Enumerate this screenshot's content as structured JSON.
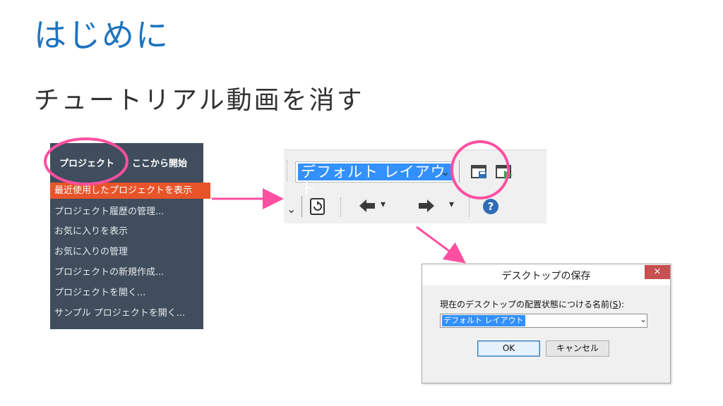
{
  "slide": {
    "title": "はじめに",
    "subtitle": "チュートリアル動画を消す"
  },
  "menu": {
    "tabs": [
      "プロジェクト",
      "ここから開始"
    ],
    "items": [
      {
        "label": "最近使用したプロジェクトを表示",
        "active": true
      },
      {
        "label": "プロジェクト履歴の管理..."
      },
      {
        "label": "お気に入りを表示"
      },
      {
        "label": "お気に入りの管理"
      },
      {
        "label": "プロジェクトの新規作成..."
      },
      {
        "label": "プロジェクトを開く..."
      },
      {
        "label": "サンプル プロジェクトを開く..."
      }
    ]
  },
  "toolbar": {
    "layout_value": "デフォルト レイアウト",
    "icons": [
      "save-layout-icon",
      "restore-layout-icon",
      "refresh-icon",
      "back-arrow-icon",
      "forward-arrow-icon",
      "help-icon"
    ]
  },
  "dialog": {
    "title": "デスクトップの保存",
    "close": "×",
    "label_prefix": "現在のデスクトップの配置状態につける名前(",
    "label_key": "S",
    "label_suffix": "):",
    "input_value": "デフォルト レイアウト",
    "ok": "OK",
    "cancel": "キャンセル"
  },
  "colors": {
    "title_blue": "#1e73be",
    "menu_bg": "#3f4d5c",
    "menu_active": "#e8542a",
    "annotation_pink": "#ff4fa0",
    "selection_blue": "#3390ff"
  }
}
